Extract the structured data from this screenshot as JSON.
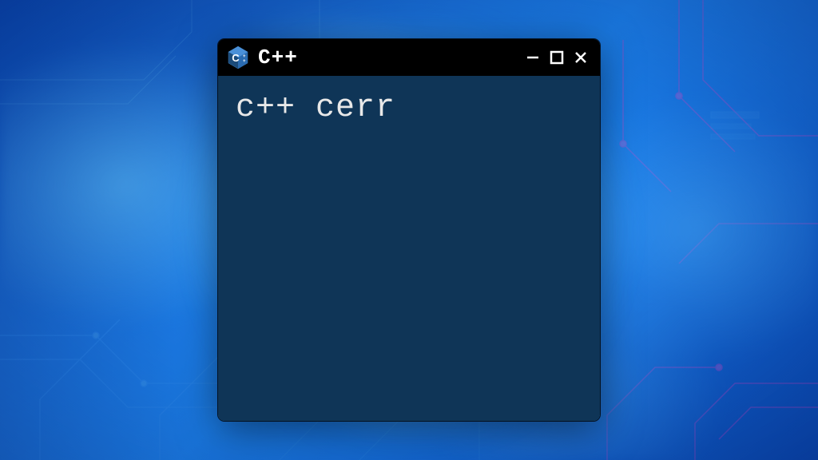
{
  "window": {
    "title": "C++",
    "icon_label": "C++",
    "content": "c++ cerr"
  },
  "colors": {
    "titlebar_bg": "#000000",
    "body_bg": "#0f3557",
    "text": "#e8e8e8",
    "accent": "#2090ff"
  }
}
